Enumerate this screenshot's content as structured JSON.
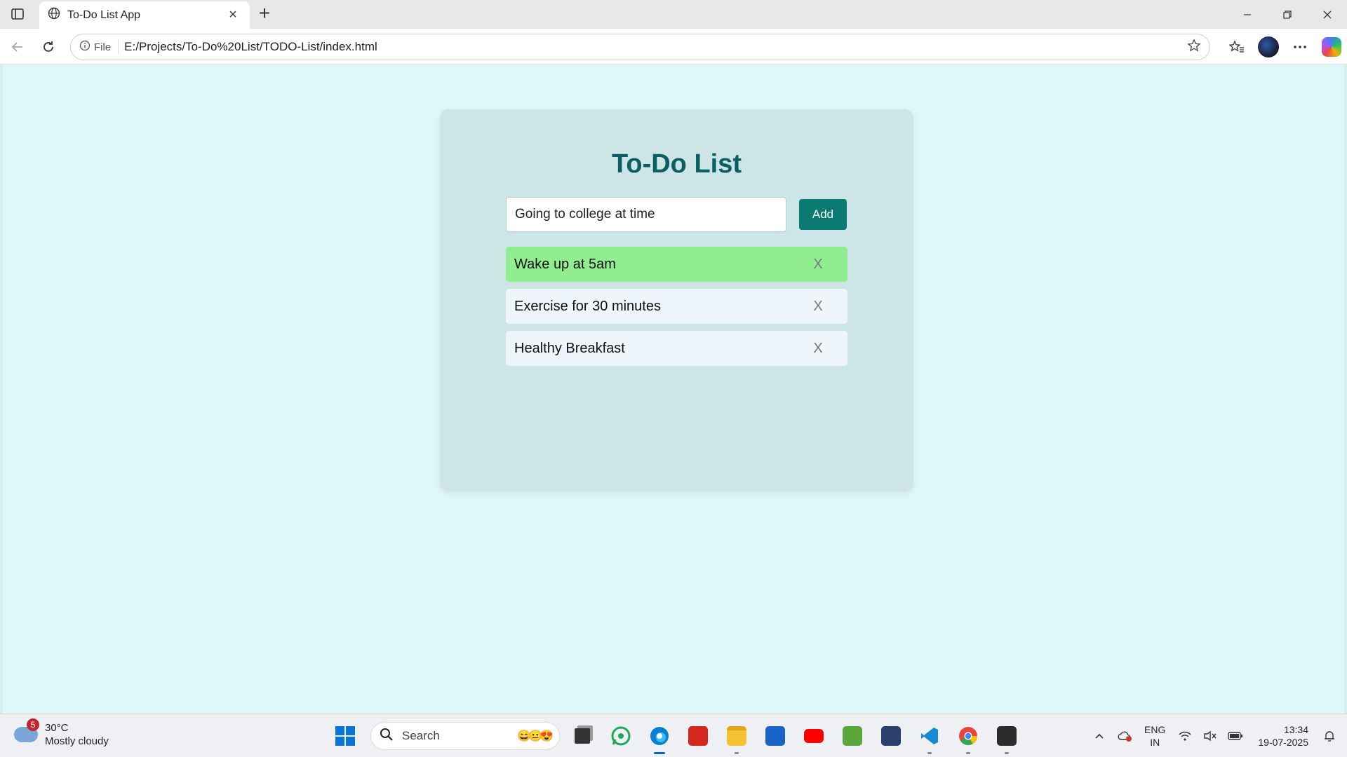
{
  "browser": {
    "tab_title": "To-Do List App",
    "tab_close": "×",
    "new_tab": "+",
    "file_label": "File",
    "url": "E:/Projects/To-Do%20List/TODO-List/index.html"
  },
  "app": {
    "title": "To-Do List",
    "input_value": "Going to college at time",
    "add_label": "Add",
    "tasks": [
      {
        "text": "Wake up at 5am",
        "completed": true,
        "delete_label": "X"
      },
      {
        "text": "Exercise for 30 minutes",
        "completed": false,
        "delete_label": "X"
      },
      {
        "text": "Healthy Breakfast",
        "completed": false,
        "delete_label": "X"
      }
    ]
  },
  "taskbar": {
    "weather_badge": "5",
    "temperature": "30°C",
    "weather_desc": "Mostly cloudy",
    "search_label": "Search",
    "search_emoji": "😄😐😍",
    "lang_line1": "ENG",
    "lang_line2": "IN",
    "time": "13:34",
    "date": "19-07-2025"
  },
  "colors": {
    "page_bg": "#e0f7f9",
    "card_bg": "#cde5e6",
    "title": "#0b5e63",
    "add_button": "#0a7a72",
    "completed_task": "#90ee8f",
    "task_bg": "#eef6fb"
  }
}
